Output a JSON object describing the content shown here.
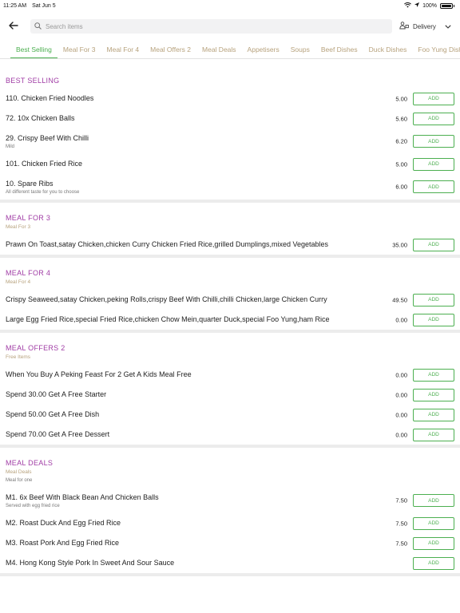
{
  "status_bar": {
    "time": "11:25 AM",
    "date": "Sat Jun 5",
    "battery": "100%"
  },
  "header": {
    "search_placeholder": "Search items",
    "delivery_label": "Delivery"
  },
  "tabs": [
    {
      "label": "Best Selling"
    },
    {
      "label": "Meal For 3"
    },
    {
      "label": "Meal For 4"
    },
    {
      "label": "Meal Offers 2"
    },
    {
      "label": "Meal Deals"
    },
    {
      "label": "Appetisers"
    },
    {
      "label": "Soups"
    },
    {
      "label": "Beef Dishes"
    },
    {
      "label": "Duck Dishes"
    },
    {
      "label": "Foo Yung Dishes"
    }
  ],
  "add_label": "ADD",
  "sections": [
    {
      "title": "BEST SELLING",
      "items": [
        {
          "name": "110. Chicken Fried Noodles",
          "price": "5.00"
        },
        {
          "name": "72. 10x Chicken Balls",
          "price": "5.60"
        },
        {
          "name": "29. Crispy Beef With Chilli",
          "desc": "Mild",
          "price": "6.20"
        },
        {
          "name": "101. Chicken Fried Rice",
          "price": "5.00"
        },
        {
          "name": "10. Spare Ribs",
          "desc": "All different taste for you to choose",
          "price": "6.00"
        }
      ]
    },
    {
      "title": "MEAL FOR 3",
      "sub_label": "Meal For 3",
      "items": [
        {
          "name": "Prawn On Toast,satay Chicken,chicken Curry Chicken Fried Rice,grilled Dumplings,mixed Vegetables",
          "price": "35.00"
        }
      ]
    },
    {
      "title": "MEAL FOR 4",
      "sub_label": "Meal For 4",
      "items": [
        {
          "name": "Crispy Seaweed,satay Chicken,peking Rolls,crispy Beef With Chilli,chilli Chicken,large Chicken Curry",
          "price": "49.50"
        },
        {
          "name": "Large Egg Fried Rice,special Fried Rice,chicken Chow Mein,quarter Duck,special Foo Yung,ham Rice",
          "price": "0.00"
        }
      ]
    },
    {
      "title": "MEAL OFFERS 2",
      "sub_label": "Free Items",
      "items": [
        {
          "name": "When You Buy A Peking Feast For 2 Get A Kids Meal Free",
          "price": "0.00"
        },
        {
          "name": "Spend 30.00 Get A Free Starter",
          "price": "0.00"
        },
        {
          "name": "Spend 50.00 Get A Free Dish",
          "price": "0.00"
        },
        {
          "name": "Spend 70.00 Get A Free Dessert",
          "price": "0.00"
        }
      ]
    },
    {
      "title": "MEAL DEALS",
      "sub_label": "Meal Deals",
      "sub_desc": "Meal for one",
      "items": [
        {
          "name": "M1. 6x Beef With Black Bean And Chicken Balls",
          "desc": "Served with egg fried rice",
          "price": "7.50"
        },
        {
          "name": "M2. Roast Duck And Egg Fried Rice",
          "price": "7.50"
        },
        {
          "name": "M3. Roast Pork And Egg Fried Rice",
          "price": "7.50"
        },
        {
          "name": "M4. Hong Kong Style Pork In Sweet And Sour Sauce",
          "price": ""
        }
      ]
    }
  ]
}
